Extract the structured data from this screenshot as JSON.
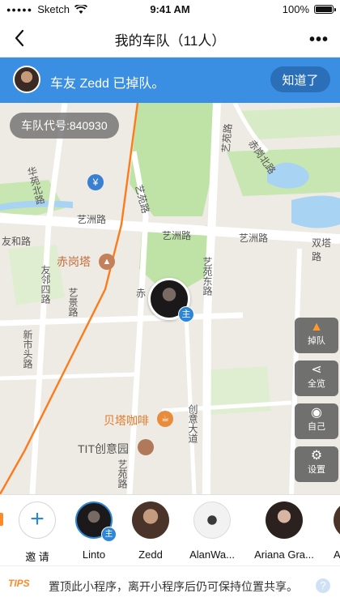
{
  "status_bar": {
    "carrier": "Sketch",
    "time": "9:41 AM",
    "battery": "100%"
  },
  "nav": {
    "title": "我的车队（11人）"
  },
  "banner": {
    "message": "车友 Zedd 已掉队。",
    "button_label": "知道了"
  },
  "map": {
    "team_code": "车队代号:840930",
    "road_labels": {
      "huahan": "华苑北路",
      "chigang": "赤岗北路",
      "yiyuan1": "艺苑路",
      "yiyuan2": "艺苑路",
      "yizhou1": "艺洲路",
      "yizhou2": "艺洲路",
      "yizhou3": "艺洲路",
      "shuanggang": "双塔路",
      "youhe": "友和路",
      "youlin": "友邻四路",
      "yijing": "艺景路",
      "xinshi": "新市头路",
      "yiyuan_bottom": "艺苑路",
      "yiyuan_east": "艺苑东路",
      "chuangyi": "创意大道"
    },
    "poi": {
      "tower": "赤岗塔",
      "cafe": "贝塔咖啡",
      "tit": "TIT创意园",
      "chi": "赤"
    },
    "marker_badge": "主"
  },
  "side_buttons": [
    {
      "label": "掉队",
      "icon": "warning-icon"
    },
    {
      "label": "全览",
      "icon": "share-icon"
    },
    {
      "label": "自己",
      "icon": "locate-icon"
    },
    {
      "label": "设置",
      "icon": "gear-icon"
    }
  ],
  "members": {
    "invite_label": "邀 请",
    "leader_badge": "主",
    "names": [
      "Linto",
      "Zedd",
      "AlanWa...",
      "Ariana Gra...",
      "A"
    ]
  },
  "tips": {
    "icon_label": "TIPS",
    "text": "置顶此小程序，离开小程序后仍可保持位置共享。",
    "help": "?"
  },
  "colors": {
    "accent": "#3b8fe2",
    "leader": "#2d86d8",
    "route": "#ff7a1a"
  }
}
